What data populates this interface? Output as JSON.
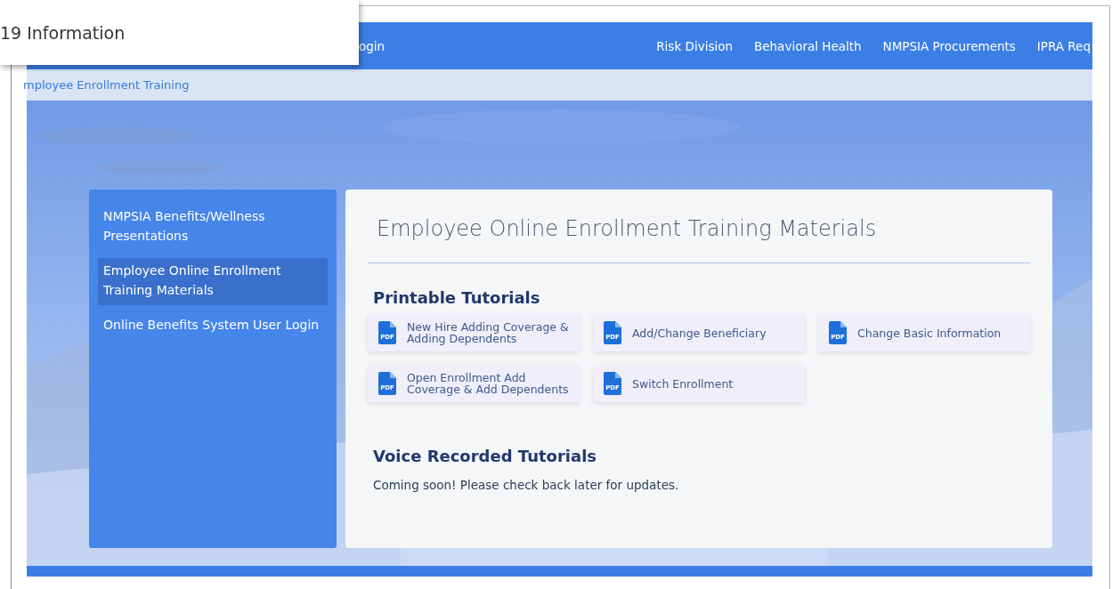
{
  "popup": {
    "text": "19 Information"
  },
  "nav": {
    "left_items": [
      "ogin"
    ],
    "right_items": [
      "Risk Division",
      "Behavioral Health",
      "NMPSIA Procurements",
      "IPRA Req"
    ]
  },
  "breadcrumb": "mployee Enrollment Training",
  "sidebar": {
    "items": [
      {
        "label": "NMPSIA Benefits/Wellness Presentations",
        "selected": false
      },
      {
        "label": "Employee Online Enrollment Training Materials",
        "selected": true
      },
      {
        "label": "Online Benefits System User Login",
        "selected": false
      }
    ]
  },
  "content": {
    "title": "Employee Online Enrollment Training Materials",
    "sections": [
      {
        "heading": "Printable Tutorials",
        "kind": "tiles",
        "tutorials": [
          {
            "label": "New Hire Adding Coverage & Adding Dependents",
            "icon_text": "PDF"
          },
          {
            "label": "Add/Change Beneficiary",
            "icon_text": "PDF"
          },
          {
            "label": "Change Basic Information",
            "icon_text": "PDF"
          },
          {
            "label": "Open Enrollment Add Coverage & Add Dependents",
            "icon_text": "PDF"
          },
          {
            "label": "Switch Enrollment",
            "icon_text": "PDF"
          }
        ]
      },
      {
        "heading": "Voice Recorded Tutorials",
        "kind": "text",
        "text": "Coming soon! Please check back later for updates."
      }
    ]
  }
}
